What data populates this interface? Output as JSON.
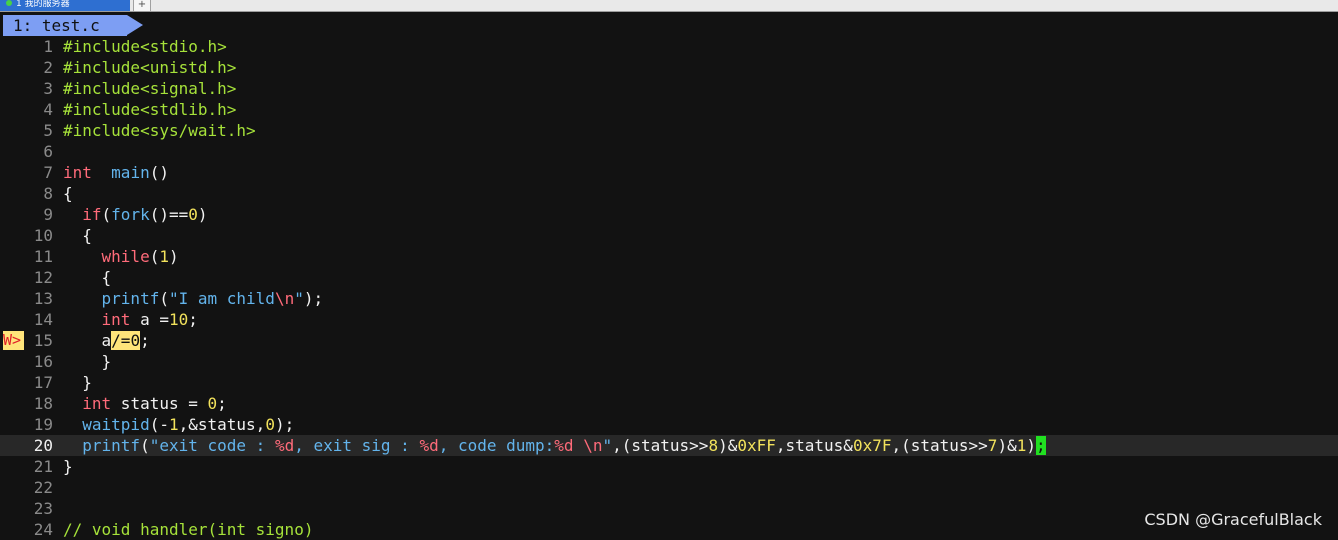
{
  "topbar": {
    "tab_label": "1 我的服务器",
    "new_tab": "+"
  },
  "buffer": {
    "label": "1: test.c"
  },
  "sign": {
    "text": "W>",
    "line": 15
  },
  "lines": [
    {
      "n": "1",
      "s": [
        [
          "pp",
          "#include<stdio.h>"
        ]
      ]
    },
    {
      "n": "2",
      "s": [
        [
          "pp",
          "#include<unistd.h>"
        ]
      ]
    },
    {
      "n": "3",
      "s": [
        [
          "pp",
          "#include<signal.h>"
        ]
      ]
    },
    {
      "n": "4",
      "s": [
        [
          "pp",
          "#include<stdlib.h>"
        ]
      ]
    },
    {
      "n": "5",
      "s": [
        [
          "pp",
          "#include<sys/wait.h>"
        ]
      ]
    },
    {
      "n": "6",
      "s": []
    },
    {
      "n": "7",
      "s": [
        [
          "ty",
          "int"
        ],
        [
          "",
          "  "
        ],
        [
          "fn",
          "main"
        ],
        [
          "",
          "()"
        ]
      ]
    },
    {
      "n": "8",
      "s": [
        [
          "",
          "{"
        ]
      ]
    },
    {
      "n": "9",
      "s": [
        [
          "",
          "  "
        ],
        [
          "kw",
          "if"
        ],
        [
          "",
          "("
        ],
        [
          "fn",
          "fork"
        ],
        [
          "",
          "()=="
        ],
        [
          "nm",
          "0"
        ],
        [
          "",
          ")"
        ]
      ]
    },
    {
      "n": "10",
      "s": [
        [
          "",
          "  {"
        ]
      ]
    },
    {
      "n": "11",
      "s": [
        [
          "",
          "    "
        ],
        [
          "kw",
          "while"
        ],
        [
          "",
          "("
        ],
        [
          "nm",
          "1"
        ],
        [
          "",
          ")"
        ]
      ]
    },
    {
      "n": "12",
      "s": [
        [
          "",
          "    {"
        ]
      ]
    },
    {
      "n": "13",
      "s": [
        [
          "",
          "    "
        ],
        [
          "fn",
          "printf"
        ],
        [
          "",
          "("
        ],
        [
          "str",
          "\"I am child"
        ],
        [
          "esc",
          "\\n"
        ],
        [
          "str",
          "\""
        ],
        [
          "",
          ");"
        ]
      ]
    },
    {
      "n": "14",
      "s": [
        [
          "",
          "    "
        ],
        [
          "ty",
          "int"
        ],
        [
          "",
          " a ="
        ],
        [
          "nm",
          "10"
        ],
        [
          "",
          ";"
        ]
      ]
    },
    {
      "n": "15",
      "s": [
        [
          "",
          "    a"
        ],
        [
          "warn",
          "/="
        ],
        [
          "warnnm",
          "0"
        ],
        [
          "",
          ";"
        ]
      ]
    },
    {
      "n": "16",
      "s": [
        [
          "",
          "    }"
        ]
      ]
    },
    {
      "n": "17",
      "s": [
        [
          "",
          "  }"
        ]
      ]
    },
    {
      "n": "18",
      "s": [
        [
          "",
          "  "
        ],
        [
          "ty",
          "int"
        ],
        [
          "",
          " status = "
        ],
        [
          "nm",
          "0"
        ],
        [
          "",
          ";"
        ]
      ]
    },
    {
      "n": "19",
      "s": [
        [
          "",
          "  "
        ],
        [
          "fn",
          "waitpid"
        ],
        [
          "",
          "(-"
        ],
        [
          "nm",
          "1"
        ],
        [
          "",
          ",&status,"
        ],
        [
          "nm",
          "0"
        ],
        [
          "",
          ");"
        ]
      ]
    },
    {
      "n": "20",
      "cur": true,
      "s": [
        [
          "",
          "  "
        ],
        [
          "fn",
          "printf"
        ],
        [
          "",
          "("
        ],
        [
          "str",
          "\"exit code : "
        ],
        [
          "esc",
          "%d"
        ],
        [
          "str",
          ", exit sig : "
        ],
        [
          "esc",
          "%d"
        ],
        [
          "str",
          ", code dump:"
        ],
        [
          "esc",
          "%d"
        ],
        [
          "str",
          " "
        ],
        [
          "esc",
          "\\n"
        ],
        [
          "str",
          "\""
        ],
        [
          "",
          ",(status>>"
        ],
        [
          "nm",
          "8"
        ],
        [
          "",
          ")&"
        ],
        [
          "nm",
          "0xFF"
        ],
        [
          "",
          ",status&"
        ],
        [
          "nm",
          "0x7F"
        ],
        [
          "",
          ",(status>>"
        ],
        [
          "nm",
          "7"
        ],
        [
          "",
          ")&"
        ],
        [
          "nm",
          "1"
        ],
        [
          "",
          ")"
        ],
        [
          "cursor",
          ";"
        ]
      ]
    },
    {
      "n": "21",
      "s": [
        [
          "",
          "}"
        ]
      ]
    },
    {
      "n": "22",
      "s": []
    },
    {
      "n": "23",
      "s": []
    },
    {
      "n": "24",
      "s": [
        [
          "cm",
          "// void handler(int signo)"
        ]
      ]
    }
  ],
  "watermark": "CSDN @GracefulBlack"
}
